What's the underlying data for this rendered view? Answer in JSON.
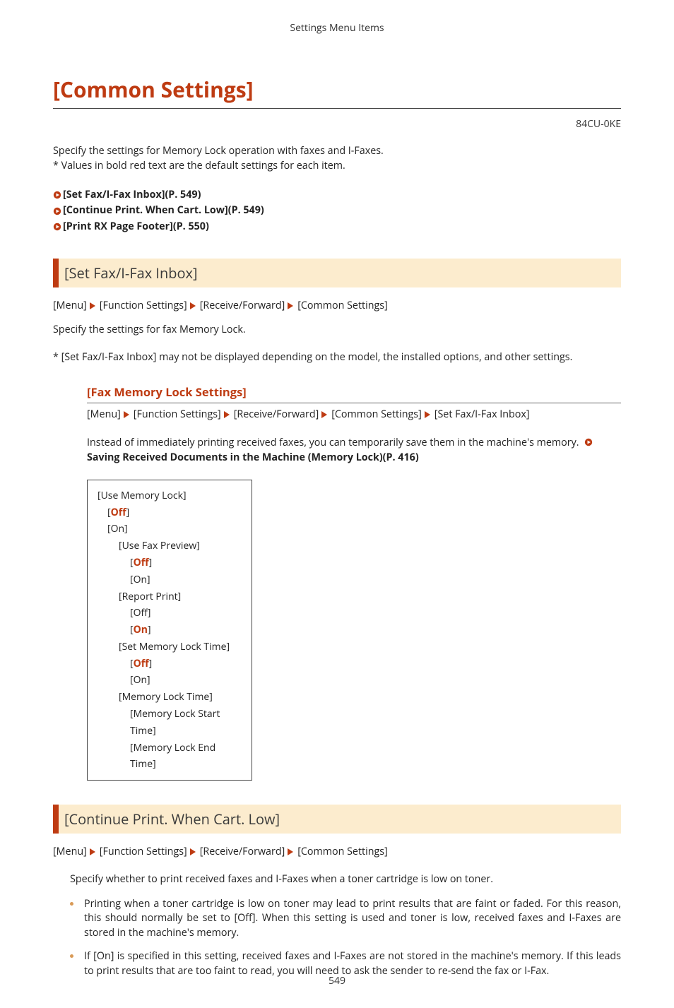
{
  "header": {
    "title": "Settings Menu Items"
  },
  "page": {
    "title": "[Common Settings]",
    "code": "84CU-0KE",
    "intro_line1": "Specify the settings for Memory Lock operation with faxes and I-Faxes.",
    "intro_line2": "* Values in bold red text are the default settings for each item.",
    "page_number": "549"
  },
  "toc": {
    "items": [
      {
        "label": "[Set Fax/I-Fax Inbox](P. 549)"
      },
      {
        "label": "[Continue Print. When Cart. Low](P. 549)"
      },
      {
        "label": "[Print RX Page Footer](P. 550)"
      }
    ]
  },
  "section1": {
    "heading": "[Set Fax/I-Fax Inbox]",
    "breadcrumb": [
      "[Menu]",
      "[Function Settings]",
      "[Receive/Forward]",
      "[Common Settings]"
    ],
    "para": "Specify the settings for fax Memory Lock.",
    "note": "* [Set Fax/I-Fax Inbox] may not be displayed depending on the model, the installed options, and other settings.",
    "sub": {
      "heading": "[Fax Memory Lock Settings]",
      "breadcrumb": [
        "[Menu]",
        "[Function Settings]",
        "[Receive/Forward]",
        "[Common Settings]",
        "[Set Fax/I-Fax Inbox]"
      ],
      "body_lead": "Instead of immediately printing received faxes, you can temporarily save them in the machine's memory. ",
      "xref": "Saving Received Documents in the Machine (Memory Lock)(P. 416)"
    },
    "tree": [
      {
        "text": "[Use Memory Lock]",
        "indent": 0,
        "default": false
      },
      {
        "text": "Off",
        "indent": 1,
        "default": true,
        "bracket": true
      },
      {
        "text": "[On]",
        "indent": 1,
        "default": false
      },
      {
        "text": "[Use Fax Preview]",
        "indent": 2,
        "default": false
      },
      {
        "text": "Off",
        "indent": 3,
        "default": true,
        "bracket": true
      },
      {
        "text": "[On]",
        "indent": 3,
        "default": false
      },
      {
        "text": "[Report Print]",
        "indent": 2,
        "default": false
      },
      {
        "text": "[Off]",
        "indent": 3,
        "default": false
      },
      {
        "text": "On",
        "indent": 3,
        "default": true,
        "bracket": true
      },
      {
        "text": "[Set Memory Lock Time]",
        "indent": 2,
        "default": false
      },
      {
        "text": "Off",
        "indent": 3,
        "default": true,
        "bracket": true
      },
      {
        "text": "[On]",
        "indent": 3,
        "default": false
      },
      {
        "text": "[Memory Lock Time]",
        "indent": 2,
        "default": false
      },
      {
        "text": "[Memory Lock Start Time]",
        "indent": 3,
        "default": false
      },
      {
        "text": "[Memory Lock End Time]",
        "indent": 3,
        "default": false
      }
    ]
  },
  "section2": {
    "heading": "[Continue Print. When Cart. Low]",
    "breadcrumb": [
      "[Menu]",
      "[Function Settings]",
      "[Receive/Forward]",
      "[Common Settings]"
    ],
    "para": "Specify whether to print received faxes and I-Faxes when a toner cartridge is low on toner.",
    "bullets": [
      "Printing when a toner cartridge is low on toner may lead to print results that are faint or faded. For this reason, this should normally be set to [Off]. When this setting is used and toner is low, received faxes and I-Faxes are stored in the machine's memory.",
      "If [On] is specified in this setting, received faxes and I-Faxes are not stored in the machine's memory. If this leads to print results that are too faint to read, you will need to ask the sender to re-send the fax or I-Fax."
    ]
  }
}
